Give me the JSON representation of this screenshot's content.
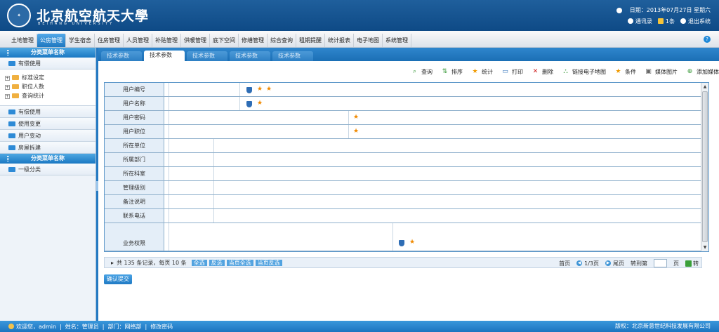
{
  "header": {
    "title": "北京航空航天大學",
    "subtitle": "BEIHANG UNIVERSITY",
    "date_label": "日期：",
    "date": "2013年07月27日 星期六",
    "contacts_label": "通讯录",
    "messages_label": "1条",
    "logout_label": "退出系统"
  },
  "nav": {
    "items": [
      "土地管理",
      "公房管理",
      "学生宿舍",
      "住房管理",
      "人员管理",
      "补贴管理",
      "供暖管理",
      "底下空间",
      "修缮管理",
      "综合查询",
      "租期提醒",
      "统计报表",
      "电子地图",
      "系统管理"
    ],
    "active_index": 1
  },
  "sidebar": {
    "head1": "分类菜单名称",
    "section_top": "有偿使用",
    "tree": [
      "标准设定",
      "职位人数",
      "查询统计"
    ],
    "sections": [
      "有偿使用",
      "使用变更",
      "用户变动",
      "房屋拆建"
    ],
    "head2": "分类菜单名称",
    "section_bottom": "一级分类"
  },
  "tabs": {
    "items": [
      "技术参数",
      "技术参数",
      "技术参数",
      "技术参数",
      "技术参数"
    ],
    "active_index": 1
  },
  "toolbar": {
    "items": [
      {
        "label": "查询",
        "icon": "search-icon"
      },
      {
        "label": "排序",
        "icon": "sort-icon"
      },
      {
        "label": "统计",
        "icon": "star-icon"
      },
      {
        "label": "打印",
        "icon": "printer-icon"
      },
      {
        "label": "删除",
        "icon": "delete-icon"
      },
      {
        "label": "链接电子地图",
        "icon": "map-link-icon"
      },
      {
        "label": "条件",
        "icon": "star-icon"
      },
      {
        "label": "媒体图片",
        "icon": "image-icon"
      },
      {
        "label": "添加媒体",
        "icon": "add-icon"
      }
    ]
  },
  "form": {
    "fields": [
      "用户编号",
      "用户名称",
      "用户密码",
      "用户职位",
      "所在单位",
      "所属部门",
      "所在科室",
      "管理级别",
      "备注说明",
      "联系电话",
      "业务权限"
    ]
  },
  "pager": {
    "summary": "共 135 条记录，每页 10 条",
    "buttons": [
      "全选",
      "反选",
      "当页全选",
      "当页反选"
    ],
    "first": "首页",
    "page_info": "1/3页",
    "last": "尾页",
    "goto_label": "转到第",
    "page_unit": "页",
    "go_label": "转"
  },
  "submit_label": "确认提交",
  "footer": {
    "welcome": "欢迎您，admin",
    "name": "姓名：管理员",
    "dept": "部门：网络部",
    "change_password": "修改密码",
    "copyright": "版权：北京新意世纪科技发展有限公司"
  }
}
